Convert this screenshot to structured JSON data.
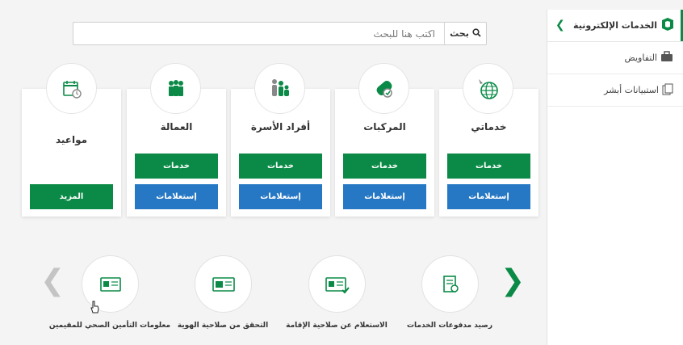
{
  "sidebar": {
    "title": "الخدمات الإلكترونية",
    "items": [
      {
        "label": "التفاويض",
        "icon": "briefcase-icon"
      },
      {
        "label": "استبيانات أبشر",
        "icon": "documents-icon"
      }
    ]
  },
  "search": {
    "placeholder": "اكتب هنا للبحث",
    "button_label": "بحث"
  },
  "cards": [
    {
      "title": "خدماتي",
      "icon": "globe-icon",
      "services_label": "خدمات",
      "inquiries_label": "إستعلامات"
    },
    {
      "title": "المركبات",
      "icon": "car-keys-icon",
      "services_label": "خدمات",
      "inquiries_label": "إستعلامات"
    },
    {
      "title": "أفراد الأسرة",
      "icon": "family-icon",
      "services_label": "خدمات",
      "inquiries_label": "إستعلامات"
    },
    {
      "title": "العمالة",
      "icon": "workers-icon",
      "services_label": "خدمات",
      "inquiries_label": "إستعلامات"
    },
    {
      "title": "مواعيد",
      "icon": "calendar-icon",
      "more_label": "المزيد"
    }
  ],
  "quick_links": [
    {
      "label": "رصيد مدفوعات الخدمات",
      "icon": "receipt-icon"
    },
    {
      "label": "الاستعلام عن صلاحية الإقامة",
      "icon": "id-check-icon"
    },
    {
      "label": "التحقق من صلاحية الهوية",
      "icon": "id-card-icon"
    },
    {
      "label": "معلومات التأمين الصحي للمقيمين",
      "icon": "insurance-card-icon"
    }
  ],
  "colors": {
    "green": "#0a8a46",
    "blue": "#2778c4"
  }
}
